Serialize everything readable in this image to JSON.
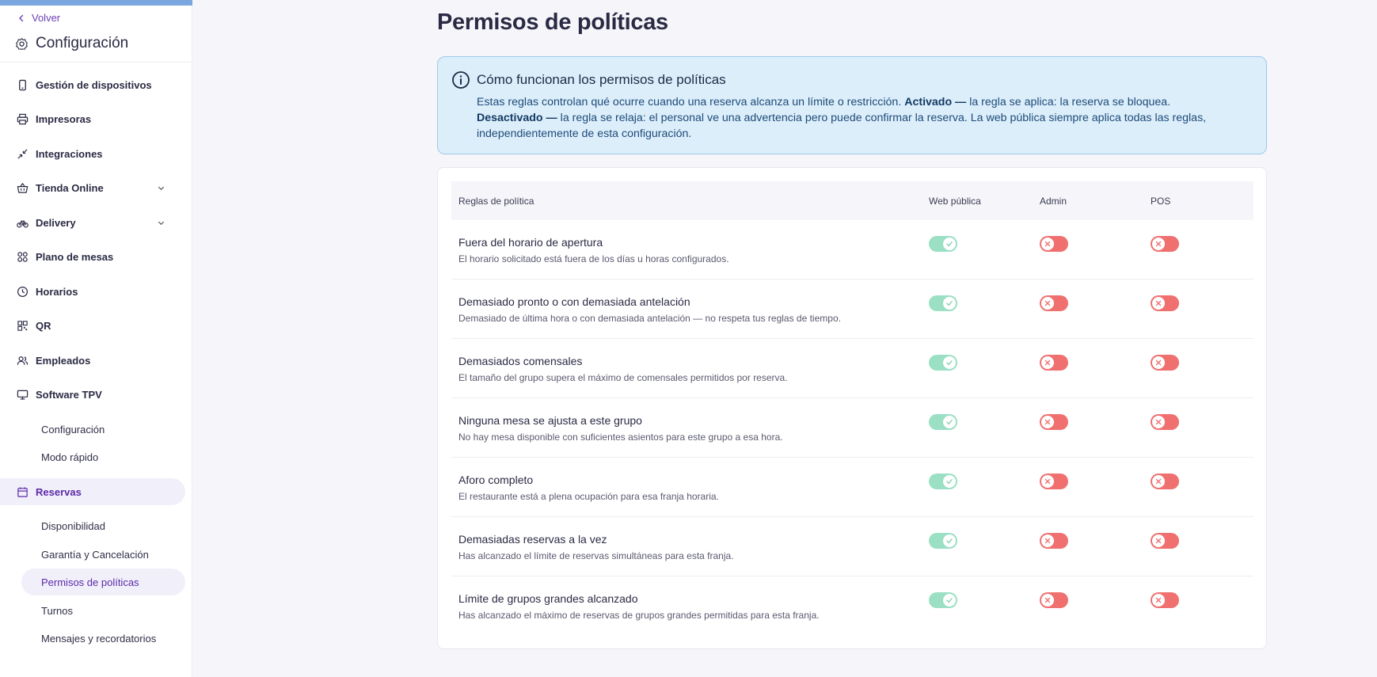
{
  "sidebar": {
    "back_label": "Volver",
    "title": "Configuración",
    "items": [
      {
        "label": "Gestión de dispositivos",
        "icon": "phone-icon"
      },
      {
        "label": "Impresoras",
        "icon": "printer-icon"
      },
      {
        "label": "Integraciones",
        "icon": "arrows-in-icon"
      },
      {
        "label": "Tienda Online",
        "icon": "basket-icon",
        "expandable": true
      },
      {
        "label": "Delivery",
        "icon": "bike-icon",
        "expandable": true
      },
      {
        "label": "Plano de mesas",
        "icon": "grid-dots-icon"
      },
      {
        "label": "Horarios",
        "icon": "clock-icon"
      },
      {
        "label": "QR",
        "icon": "qr-icon"
      },
      {
        "label": "Empleados",
        "icon": "users-icon"
      },
      {
        "label": "Software TPV",
        "icon": "monitor-icon"
      }
    ],
    "tpv_sub": [
      "Configuración",
      "Modo rápido"
    ],
    "reservas_label": "Reservas",
    "reservas_sub": [
      "Disponibilidad",
      "Garantía y Cancelación",
      "Permisos de políticas",
      "Turnos",
      "Mensajes y recordatorios"
    ],
    "active_sub": "Permisos de políticas"
  },
  "page": {
    "title": "Permisos de políticas"
  },
  "info": {
    "title": "Cómo funcionan los permisos de políticas",
    "body_1": "Estas reglas controlan qué ocurre cuando una reserva alcanza un límite o restricción. ",
    "on_label": "Activado —",
    "body_2": " la regla se aplica: la reserva se bloquea. ",
    "off_label": "Desactivado —",
    "body_3": " la regla se relaja: el personal ve una advertencia pero puede confirmar la reserva. La web pública siempre aplica todas las reglas, independientemente de esta configuración."
  },
  "table": {
    "headers": [
      "Reglas de política",
      "Web pública",
      "Admin",
      "POS"
    ],
    "rows": [
      {
        "title": "Fuera del horario de apertura",
        "desc": "El horario solicitado está fuera de los días u horas configurados.",
        "web": true,
        "admin": false,
        "pos": false
      },
      {
        "title": "Demasiado pronto o con demasiada antelación",
        "desc": "Demasiado de última hora o con demasiada antelación — no respeta tus reglas de tiempo.",
        "web": true,
        "admin": false,
        "pos": false
      },
      {
        "title": "Demasiados comensales",
        "desc": "El tamaño del grupo supera el máximo de comensales permitidos por reserva.",
        "web": true,
        "admin": false,
        "pos": false
      },
      {
        "title": "Ninguna mesa se ajusta a este grupo",
        "desc": "No hay mesa disponible con suficientes asientos para este grupo a esa hora.",
        "web": true,
        "admin": false,
        "pos": false
      },
      {
        "title": "Aforo completo",
        "desc": "El restaurante está a plena ocupación para esa franja horaria.",
        "web": true,
        "admin": false,
        "pos": false
      },
      {
        "title": "Demasiadas reservas a la vez",
        "desc": "Has alcanzado el límite de reservas simultáneas para esta franja.",
        "web": true,
        "admin": false,
        "pos": false
      },
      {
        "title": "Límite de grupos grandes alcanzado",
        "desc": "Has alcanzado el máximo de reservas de grupos grandes permitidas para esta franja.",
        "web": true,
        "admin": false,
        "pos": false
      }
    ]
  },
  "colors": {
    "accent": "#5b2aa8",
    "toggle_on": "#9be0c4",
    "toggle_off": "#f07070",
    "info_bg": "#ddeefb"
  }
}
